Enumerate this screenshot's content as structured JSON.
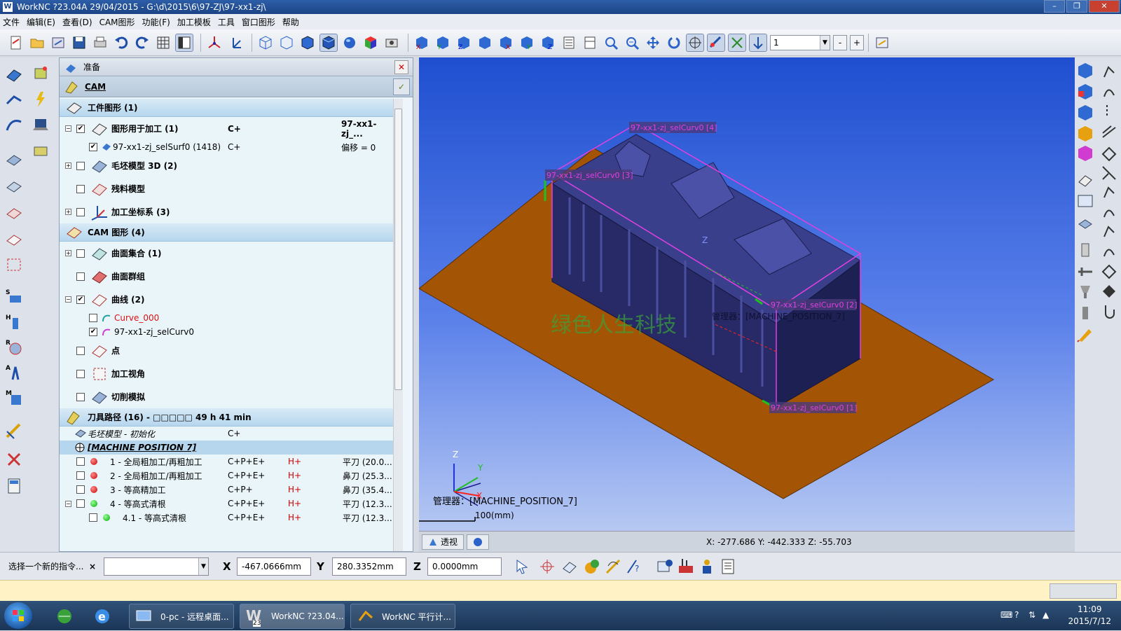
{
  "window": {
    "title": "WorkNC ?23.04A    29/04/2015 - G:\\d\\2015\\6\\97-ZJ\\97-xx1-zj\\",
    "logo_text": "W",
    "minimize_icon": "minimize-icon",
    "maximize_icon": "maximize-icon",
    "close_icon": "close-icon"
  },
  "menu": [
    "文件",
    "编辑(E)",
    "查看(D)",
    "CAM图形",
    "功能(F)",
    "加工模板",
    "工具",
    "窗口图形",
    "帮助"
  ],
  "toolbar": {
    "layer_value": "1",
    "minus_label": "-",
    "plus_label": "+"
  },
  "panel": {
    "title": "准备",
    "cam_label": "CAM",
    "close_label": "✕",
    "confirm_label": "✓"
  },
  "tree": {
    "workpiece_section": "工件图形 (1)",
    "workpiece_items": [
      {
        "label": "图形用于加工 (1)",
        "col2": "C+",
        "col3": "97-xx1-zj_...",
        "checked": true
      },
      {
        "label": "97-xx1-zj_selSurf0 (1418)",
        "col2": "C+",
        "col3": "偏移 = 0",
        "checked": true
      },
      {
        "label": "毛坯模型 3D (2)",
        "col2": "",
        "col3": "",
        "checked": false
      },
      {
        "label": "残料模型",
        "col2": "",
        "col3": "",
        "checked": false
      },
      {
        "label": "加工坐标系 (3)",
        "col2": "",
        "col3": "",
        "checked": false
      }
    ],
    "cam_section": "CAM 图形 (4)",
    "cam_items": [
      {
        "label": "曲面集合 (1)"
      },
      {
        "label": "曲面群组"
      },
      {
        "label": "曲线 (2)"
      },
      {
        "label": "Curve_000"
      },
      {
        "label": "97-xx1-zj_selCurv0"
      },
      {
        "label": "点"
      },
      {
        "label": "加工视角"
      },
      {
        "label": "切削模拟"
      }
    ],
    "toolpath_section": "刀具路径 (16) - □□□□□ 49 h 41 min",
    "toolpath_init": {
      "label": "毛坯模型 - 初始化",
      "col2": "C+"
    },
    "machine_position": "[MACHINE POSITION 7]",
    "toolpaths": [
      {
        "label": "1 - 全局粗加工/再粗加工",
        "col2": "C+P+E+",
        "h": "H+",
        "tool": "平刀 (20.0...",
        "status": "red"
      },
      {
        "label": "2 - 全局粗加工/再粗加工",
        "col2": "C+P+E+",
        "h": "H+",
        "tool": "鼻刀 (25.3...",
        "status": "red"
      },
      {
        "label": "3 - 等高精加工",
        "col2": "C+P+",
        "h": "H+",
        "tool": "鼻刀 (35.4...",
        "status": "red"
      },
      {
        "label": "4 - 等高式清根",
        "col2": "C+P+E+",
        "h": "H+",
        "tool": "平刀 (12.3...",
        "status": "green"
      },
      {
        "label": "4.1 - 等高式清根",
        "col2": "C+P+E+",
        "h": "H+",
        "tool": "平刀 (12.3...",
        "status": "green"
      }
    ]
  },
  "viewport": {
    "curve_labels": [
      "97-xx1-zj_selCurv0 [4]",
      "97-xx1-zj_selCurv0 [3]",
      "97-xx1-zj_selCurv0 [2]",
      "97-xx1-zj_selCurv0 [1]"
    ],
    "watermark": "绿色人生科技",
    "manager_inline": "管理器：[MACHINE_POSITION_7]",
    "axis_z": "Z",
    "axis_y": "Y",
    "axis_x": "X",
    "manager_label": "管理器：[MACHINE_POSITION_7]",
    "scale_label": "100(mm)",
    "view_tab": "透视",
    "coords": "X: -277.686   Y: -442.333   Z: -55.703",
    "colors": {
      "part": "#2a2d6e",
      "plate": "#a35505",
      "curve": "#e040e0"
    }
  },
  "command": {
    "prompt": "选择一个新的指令...",
    "close_label": "×",
    "x_label": "X",
    "x_value": "-467.0666mm",
    "y_label": "Y",
    "y_value": "280.3352mm",
    "z_label": "Z",
    "z_value": "0.0000mm"
  },
  "taskbar": {
    "apps": [
      {
        "label": "0-pc - 远程桌面...",
        "active": false
      },
      {
        "label": "WorkNC ?23.04...",
        "active": true
      },
      {
        "label": "WorkNC 平行计...",
        "active": false
      }
    ],
    "app_badge": "23",
    "time": "11:09",
    "date": "2015/7/12"
  }
}
